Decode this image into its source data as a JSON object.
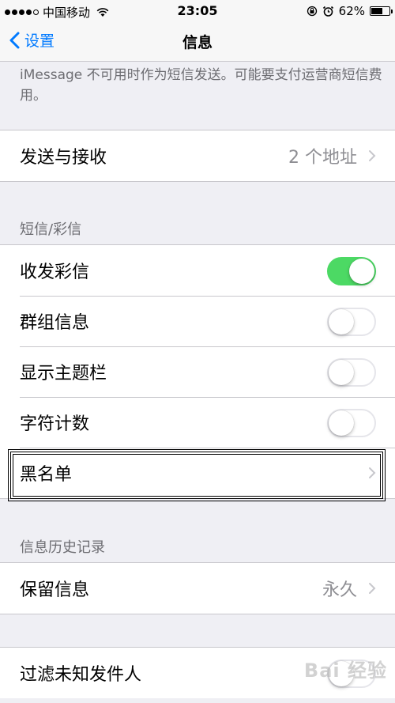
{
  "status_bar": {
    "carrier": "中国移动",
    "time": "23:05",
    "battery_percent": "62%",
    "battery_level": 0.62,
    "signal_dots": 4
  },
  "nav": {
    "back_label": "设置",
    "title": "信息"
  },
  "imessage_note": "iMessage 不可用时作为短信发送。可能要支付运营商短信费用。",
  "send_receive": {
    "label": "发送与接收",
    "detail": "2 个地址"
  },
  "sms_section": {
    "header": "短信/彩信",
    "rows": [
      {
        "label": "收发彩信",
        "on": true
      },
      {
        "label": "群组信息",
        "on": false
      },
      {
        "label": "显示主题栏",
        "on": false
      },
      {
        "label": "字符计数",
        "on": false
      }
    ],
    "blacklist_label": "黑名单"
  },
  "history_section": {
    "header": "信息历史记录",
    "keep_label": "保留信息",
    "keep_value": "永久"
  },
  "filter": {
    "label": "过滤未知发件人",
    "on": false
  },
  "watermark": "Bai 经验",
  "colors": {
    "accent": "#007aff",
    "toggle_on": "#4cd964",
    "background": "#efeff4"
  }
}
